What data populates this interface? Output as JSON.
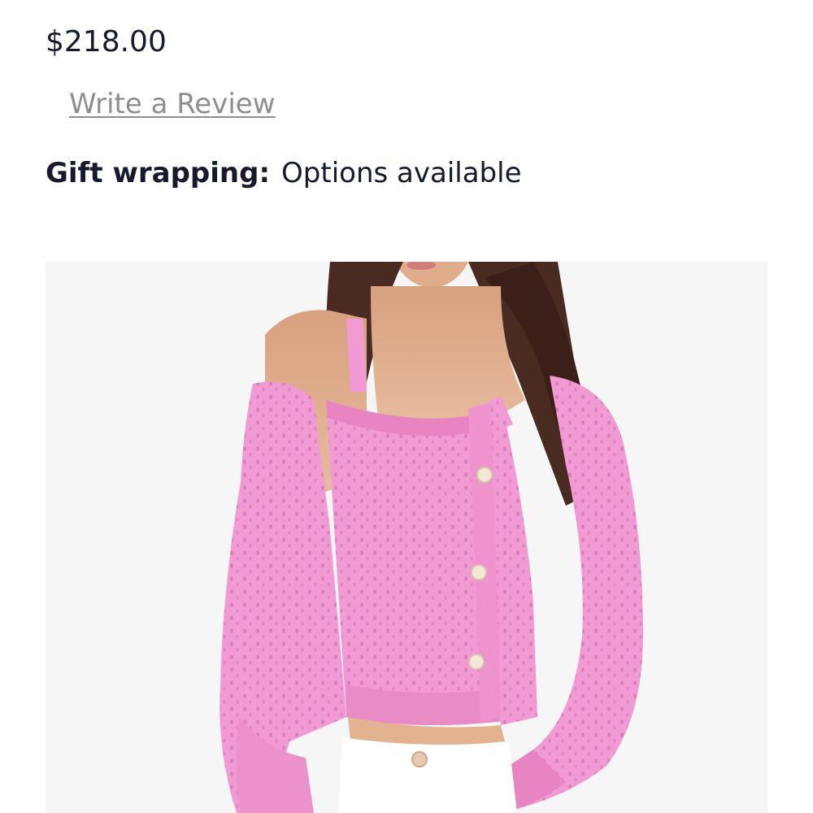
{
  "product": {
    "price": "$218.00",
    "review_link_label": "Write a Review",
    "gift_wrapping_label": "Gift wrapping:",
    "gift_wrapping_value": "Options available"
  },
  "image": {
    "subject": "pink open-knit cardigan and matching tank",
    "colors": {
      "background": "#f6f6f7",
      "knit": "#f29ad3",
      "knit_shadow": "#d874b6",
      "skin": "#e3b291",
      "hair": "#4a2b22",
      "pants": "#ffffff",
      "button": "#f3e7d6"
    }
  }
}
